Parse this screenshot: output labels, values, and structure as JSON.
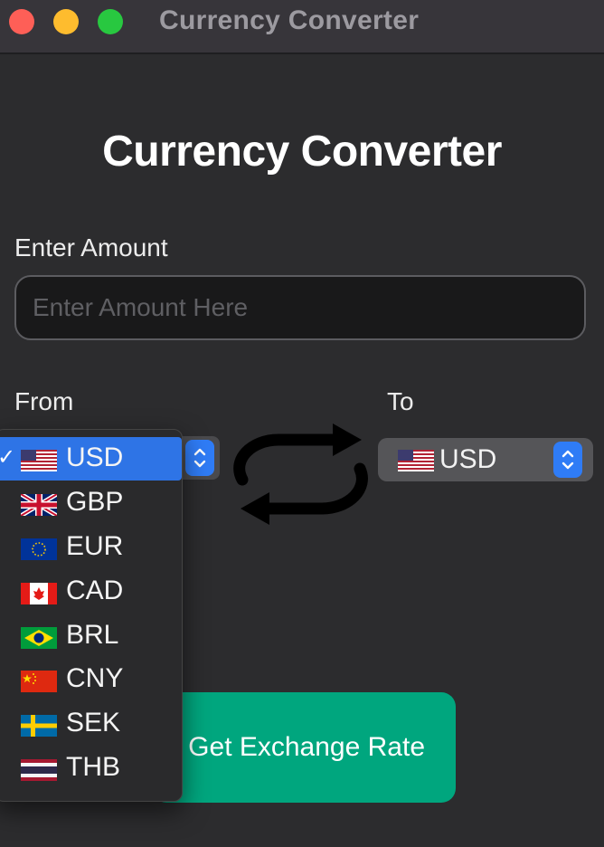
{
  "window": {
    "title": "Currency Converter"
  },
  "app": {
    "title": "Currency Converter"
  },
  "amount": {
    "label": "Enter Amount",
    "value": "",
    "placeholder": "Enter Amount Here"
  },
  "from": {
    "label": "From",
    "selected": "USD",
    "check_mark": "✓",
    "options": [
      {
        "code": "USD",
        "flag": "us-flag-icon"
      },
      {
        "code": "GBP",
        "flag": "uk-flag-icon"
      },
      {
        "code": "EUR",
        "flag": "eu-flag-icon"
      },
      {
        "code": "CAD",
        "flag": "canada-flag-icon"
      },
      {
        "code": "BRL",
        "flag": "brazil-flag-icon"
      },
      {
        "code": "CNY",
        "flag": "china-flag-icon"
      },
      {
        "code": "SEK",
        "flag": "sweden-flag-icon"
      },
      {
        "code": "THB",
        "flag": "thailand-flag-icon"
      }
    ]
  },
  "to": {
    "label": "To",
    "selected": "USD",
    "flag": "us-flag-icon"
  },
  "swap": {
    "icon": "swap-arrows-icon"
  },
  "action": {
    "label": "Get Exchange Rate"
  },
  "colors": {
    "background": "#2c2c2e",
    "accent_blue": "#2f7cf6",
    "button_green": "#00a67e",
    "titlebar": "#37353a"
  }
}
